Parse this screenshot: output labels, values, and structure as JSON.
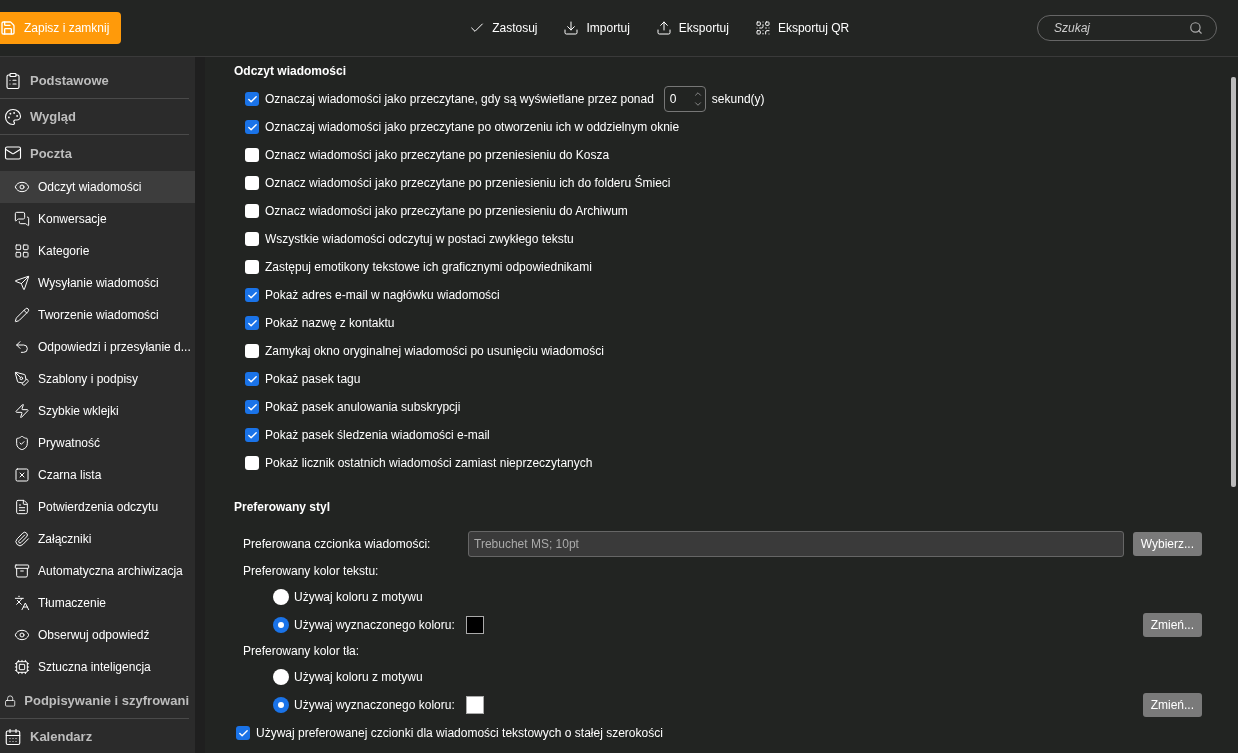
{
  "toolbar": {
    "save_button": "Zapisz i zamknij",
    "actions": [
      {
        "label": "Zastosuj"
      },
      {
        "label": "Importuj"
      },
      {
        "label": "Eksportuj"
      },
      {
        "label": "Eksportuj QR"
      }
    ],
    "search": {
      "placeholder": "Szukaj"
    }
  },
  "sidebar": {
    "sections": [
      {
        "label": "Podstawowe"
      },
      {
        "label": "Wygląd"
      },
      {
        "label": "Poczta",
        "children": [
          {
            "label": "Odczyt wiadomości",
            "selected": true
          },
          {
            "label": "Konwersacje",
            "selected": false
          },
          {
            "label": "Kategorie",
            "selected": false
          },
          {
            "label": "Wysyłanie wiadomości",
            "selected": false
          },
          {
            "label": "Tworzenie wiadomości",
            "selected": false
          },
          {
            "label": "Odpowiedzi i przesyłanie d...",
            "selected": false
          },
          {
            "label": "Szablony i podpisy",
            "selected": false
          },
          {
            "label": "Szybkie wklejki",
            "selected": false
          },
          {
            "label": "Prywatność",
            "selected": false
          },
          {
            "label": "Czarna lista",
            "selected": false
          },
          {
            "label": "Potwierdzenia odczytu",
            "selected": false
          },
          {
            "label": "Załączniki",
            "selected": false
          },
          {
            "label": "Automatyczna archiwizacja",
            "selected": false
          },
          {
            "label": "Tłumaczenie",
            "selected": false
          },
          {
            "label": "Obserwuj odpowiedź",
            "selected": false
          },
          {
            "label": "Sztuczna inteligencja",
            "selected": false
          }
        ]
      },
      {
        "label": "Podpisywanie i szyfrowani"
      },
      {
        "label": "Kalendarz"
      }
    ]
  },
  "reading": {
    "title": "Odczyt wiadomości",
    "options": [
      {
        "label": "Oznaczaj wiadomości jako przeczytane, gdy są wyświetlane przez ponad",
        "checked": true,
        "spinner": {
          "value": "0",
          "suffix": "sekund(y)"
        }
      },
      {
        "label": "Oznaczaj wiadomości jako przeczytane po otworzeniu ich w oddzielnym oknie",
        "checked": true
      },
      {
        "label": "Oznacz wiadomości jako przeczytane po przeniesieniu do Kosza",
        "checked": false
      },
      {
        "label": "Oznacz wiadomości jako przeczytane po przeniesieniu ich do folderu Śmieci",
        "checked": false
      },
      {
        "label": "Oznacz wiadomości jako przeczytane po przeniesieniu do Archiwum",
        "checked": false
      },
      {
        "label": "Wszystkie wiadomości odczytuj w postaci zwykłego tekstu",
        "checked": false
      },
      {
        "label": "Zastępuj emotikony tekstowe ich graficznymi odpowiednikami",
        "checked": false
      },
      {
        "label": "Pokaż adres e-mail w nagłówku wiadomości",
        "checked": true
      },
      {
        "label": "Pokaż nazwę z kontaktu",
        "checked": true
      },
      {
        "label": "Zamykaj okno oryginalnej wiadomości po usunięciu wiadomości",
        "checked": false
      },
      {
        "label": "Pokaż pasek tagu",
        "checked": true
      },
      {
        "label": "Pokaż pasek anulowania subskrypcji",
        "checked": true
      },
      {
        "label": "Pokaż pasek śledzenia wiadomości e-mail",
        "checked": true
      },
      {
        "label": "Pokaż licznik ostatnich wiadomości zamiast nieprzeczytanych",
        "checked": false
      }
    ]
  },
  "style": {
    "title": "Preferowany styl",
    "font": {
      "label": "Preferowana czcionka wiadomości:",
      "value": "Trebuchet MS; 10pt",
      "button": "Wybierz..."
    },
    "color_groups": [
      {
        "label": "Preferowany kolor tekstu:",
        "button": "Zmień...",
        "options": [
          {
            "label": "Używaj koloru z motywu",
            "selected": false
          },
          {
            "label": "Używaj wyznaczonego koloru:",
            "selected": true,
            "color": "#000000"
          }
        ]
      },
      {
        "label": "Preferowany kolor tła:",
        "button": "Zmień...",
        "options": [
          {
            "label": "Używaj koloru z motywu",
            "selected": false
          },
          {
            "label": "Używaj wyznaczonego koloru:",
            "selected": true,
            "color": "#ffffff"
          }
        ]
      }
    ],
    "monospace": {
      "label": "Używaj preferowanej czcionki dla wiadomości tekstowych o stałej szerokości",
      "checked": true
    }
  }
}
